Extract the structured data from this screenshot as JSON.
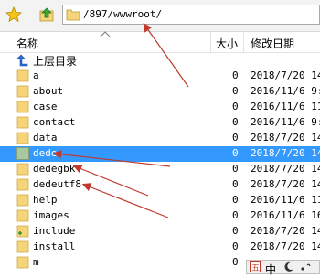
{
  "window": {
    "toolbar": {
      "favorite_icon": "star-icon",
      "up_icon": "up-folder-icon",
      "path": "/897/wwwroot/"
    },
    "columns": {
      "name": "名称",
      "size": "大小",
      "modified": "修改日期"
    },
    "rows": [
      {
        "name": "上层目录",
        "size": "",
        "date": "",
        "icon": "parent-directory-icon"
      },
      {
        "name": "a",
        "size": "0",
        "date": "2018/7/20 14:",
        "icon": "folder-icon"
      },
      {
        "name": "about",
        "size": "0",
        "date": "2016/11/6 9:2",
        "icon": "folder-icon"
      },
      {
        "name": "case",
        "size": "0",
        "date": "2016/11/6 11:",
        "icon": "folder-icon"
      },
      {
        "name": "contact",
        "size": "0",
        "date": "2016/11/6 9:2",
        "icon": "folder-icon"
      },
      {
        "name": "data",
        "size": "0",
        "date": "2018/7/20 14:",
        "icon": "folder-icon"
      },
      {
        "name": "dede",
        "size": "0",
        "date": "2018/7/20 14:",
        "icon": "folder-icon",
        "selected": true
      },
      {
        "name": "dedegbk",
        "size": "0",
        "date": "2018/7/20 14:",
        "icon": "folder-icon"
      },
      {
        "name": "dedeutf8",
        "size": "0",
        "date": "2018/7/20 14:",
        "icon": "folder-icon"
      },
      {
        "name": "help",
        "size": "0",
        "date": "2016/11/6 11:",
        "icon": "folder-icon"
      },
      {
        "name": "images",
        "size": "0",
        "date": "2016/11/6 16:",
        "icon": "folder-icon"
      },
      {
        "name": "include",
        "size": "0",
        "date": "2018/7/20 14:",
        "icon": "folder-icon"
      },
      {
        "name": "install",
        "size": "0",
        "date": "2018/7/20 14:",
        "icon": "folder-icon"
      },
      {
        "name": "m",
        "size": "0",
        "date": "",
        "icon": "folder-icon"
      }
    ],
    "ime_bar": {
      "mode": "中",
      "icons": [
        "ime-logo-icon",
        "moon-icon",
        "punctuation-icon"
      ]
    },
    "colors": {
      "selection": "#3399ff",
      "annotation_arrow": "#c0392b",
      "folder": "#f6d57a"
    }
  }
}
